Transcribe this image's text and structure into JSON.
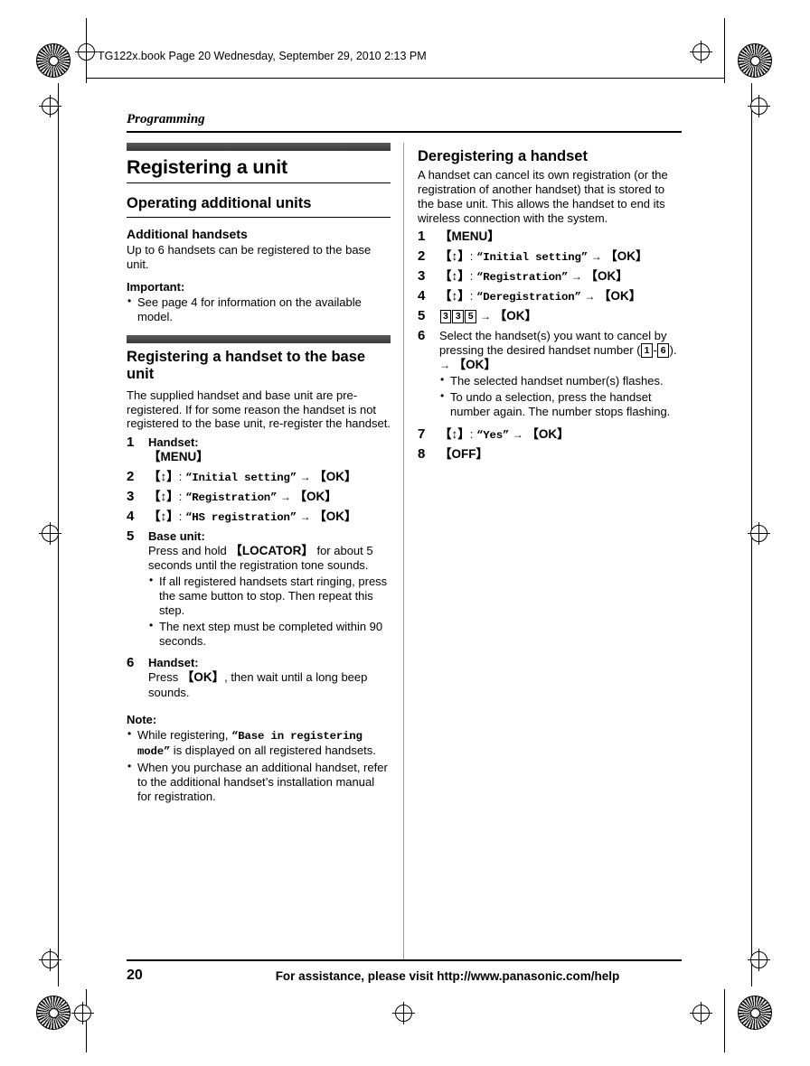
{
  "page": {
    "book_line": "TG122x.book  Page 20  Wednesday, September 29, 2010  2:13 PM",
    "running_head": "Programming",
    "folio": "20",
    "footer": "For assistance, please visit http://www.panasonic.com/help"
  },
  "left": {
    "title": "Registering a unit",
    "sub1": "Operating additional units",
    "sub2": "Additional handsets",
    "p1": "Up to 6 handsets can be registered to the base unit.",
    "important_label": "Important:",
    "important_bullets": [
      "See page 4 for information on the available model."
    ],
    "sub3": "Registering a handset to the base unit",
    "p2": "The supplied handset and base unit are pre-registered. If for some reason the handset is not registered to the base unit, re-register the handset.",
    "steps": [
      {
        "num": "1",
        "label": "Handset:",
        "key": "{MENU}"
      },
      {
        "num": "2",
        "joy": "{^}",
        "text": "“Initial setting”",
        "arrow": "→",
        "key": "{OK}"
      },
      {
        "num": "3",
        "joy": "{^}",
        "text": "“Registration”",
        "arrow": "→",
        "key": "{OK}"
      },
      {
        "num": "4",
        "joy": "{^}",
        "text": "“HS registration”",
        "arrow": "→",
        "key": "{OK}"
      },
      {
        "num": "5",
        "label": "Base unit:",
        "body_pre": "Press and hold ",
        "key": "{LOCATOR}",
        "body_post": " for about 5 seconds until the registration tone sounds.",
        "bullets": [
          "If all registered handsets start ringing, press the same button to stop. Then repeat this step.",
          "The next step must be completed within 90 seconds."
        ]
      },
      {
        "num": "6",
        "label": "Handset:",
        "body_pre": "Press ",
        "key": "{OK}",
        "body_post": ", then wait until a long beep sounds."
      }
    ],
    "note_label": "Note:",
    "note_bullets": [
      {
        "pre": "While registering, ",
        "mono": "“Base in registering mode”",
        "post": " is displayed on all registered handsets."
      },
      {
        "pre": "When you purchase an additional handset, refer to the additional handset’s installation manual for registration.",
        "mono": "",
        "post": ""
      }
    ]
  },
  "right": {
    "title": "Deregistering a handset",
    "p1": "A handset can cancel its own registration (or the registration of another handset) that is stored to the base unit. This allows the handset to end its wireless connection with the system.",
    "steps": [
      {
        "num": "1",
        "key": "{MENU}"
      },
      {
        "num": "2",
        "joy": "{^}",
        "text": "“Initial setting”",
        "arrow": "→",
        "key": "{OK}"
      },
      {
        "num": "3",
        "joy": "{^}",
        "text": "“Registration”",
        "arrow": "→",
        "key": "{OK}"
      },
      {
        "num": "4",
        "joy": "{^}",
        "text": "“Deregistration”",
        "arrow": "→",
        "key": "{OK}"
      },
      {
        "num": "5",
        "digits": [
          "3",
          "3",
          "5"
        ],
        "arrow": "→",
        "key": "{OK}"
      },
      {
        "num": "6",
        "body": "Select the handset(s) you want to cancel by pressing the desired handset number",
        "range_open": "(",
        "range_from": "1",
        "range_dash": "-",
        "range_to": "6",
        "range_close": ").",
        "arrow": "→",
        "key": "{OK}",
        "bullets": [
          "The selected handset number(s) flashes.",
          "To undo a selection, press the handset number again. The number stops flashing."
        ]
      },
      {
        "num": "7",
        "joy": "{^}",
        "text": "“Yes”",
        "arrow": "→",
        "key": "{OK}"
      },
      {
        "num": "8",
        "key": "{OFF}"
      }
    ]
  }
}
